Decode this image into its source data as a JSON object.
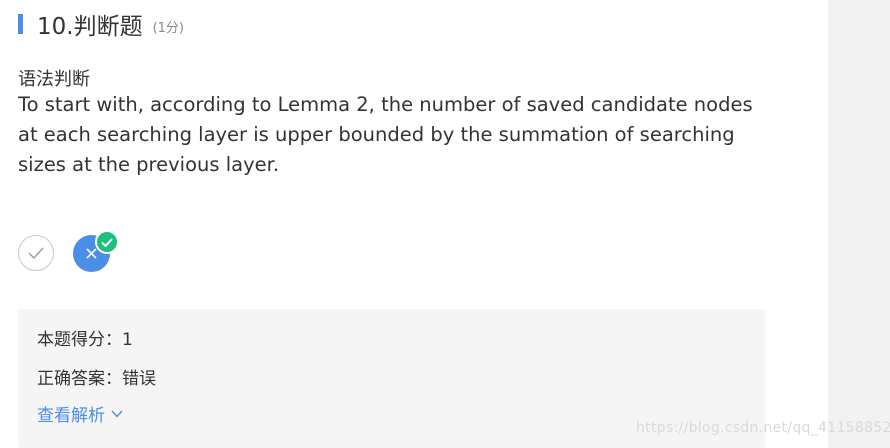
{
  "question": {
    "title": "10.判断题",
    "score_note": "(1分)",
    "type_label": "语法判断",
    "text": "To start with, according to Lemma 2, the number of saved candidate nodes at each searching layer is upper bounded by the summation of searching sizes at the previous layer."
  },
  "options": [
    {
      "icon": "check-icon",
      "selected": false
    },
    {
      "icon": "close-icon",
      "selected": true,
      "badge": "check-icon"
    }
  ],
  "result": {
    "score_line": "本题得分：1",
    "answer_line": "正确答案：错误",
    "analysis_link": "查看解析"
  },
  "watermark": "https://blog.csdn.net/qq_41158852",
  "colors": {
    "accent": "#4a8ee8",
    "badge": "#1ec07a",
    "result_bg": "#f5f5f5",
    "side_panel": "#f2f2f2"
  }
}
